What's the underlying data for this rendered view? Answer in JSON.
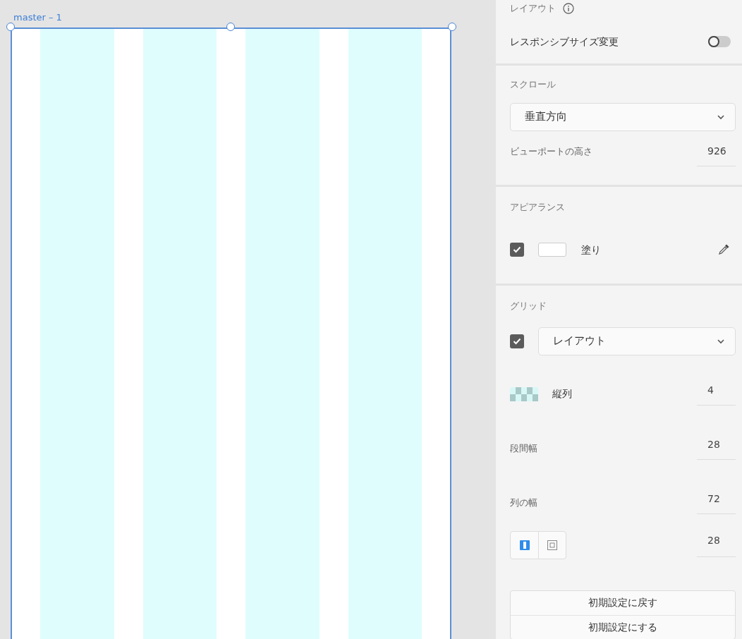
{
  "artboard": {
    "title": "master – 1"
  },
  "panel": {
    "layout": {
      "title": "レイアウト",
      "responsive": {
        "label": "レスポンシブサイズ変更",
        "on": false
      }
    },
    "scroll": {
      "title": "スクロール",
      "mode": "垂直方向",
      "viewport": {
        "label": "ビューポートの高さ",
        "value": "926"
      }
    },
    "appearance": {
      "title": "アピアランス",
      "fill": {
        "checked": true,
        "label": "塗り",
        "color": "#ffffff"
      }
    },
    "grid": {
      "title": "グリッド",
      "enabled": true,
      "type": "レイアウト",
      "fields": [
        {
          "kind": "columns",
          "label": "縦列",
          "value": "4"
        },
        {
          "kind": "plain",
          "label": "段間幅",
          "value": "28"
        },
        {
          "kind": "plain",
          "label": "列の幅",
          "value": "72"
        },
        {
          "kind": "modes",
          "value": "28",
          "modes": [
            {
              "kind": "columns",
              "selected": true
            },
            {
              "kind": "square",
              "selected": false
            }
          ]
        }
      ],
      "buttons": [
        "初期設定に戻す",
        "初期設定にする"
      ]
    }
  }
}
